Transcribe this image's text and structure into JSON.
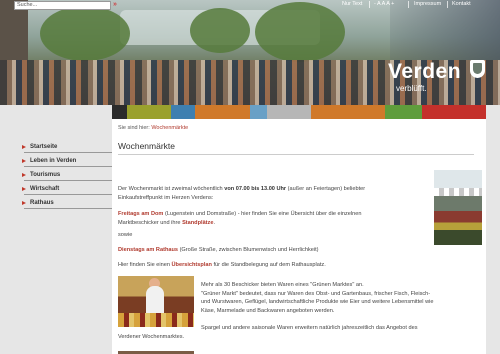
{
  "header": {
    "search_placeholder": "Suche...",
    "search_go": "»",
    "nav": {
      "nur_text": "Nur Text",
      "font_sizes": "- A A A +",
      "impressum": "Impressum",
      "kontakt": "Kontakt"
    },
    "brand_name": "Verden",
    "brand_tagline": "verblüfft."
  },
  "colorbar": [
    "#2b2b2b",
    "#9aa12d",
    "#3e7fb0",
    "#d0792a",
    "#69a0c6",
    "#b6b6b6",
    "#d0792a",
    "#5f9d3c",
    "#c4302b"
  ],
  "sidebar": {
    "items": [
      {
        "label": "Startseite"
      },
      {
        "label": "Leben in Verden"
      },
      {
        "label": "Tourismus"
      },
      {
        "label": "Wirtschaft"
      },
      {
        "label": "Rathaus"
      }
    ]
  },
  "main": {
    "breadcrumb_prefix": "Sie sind hier:",
    "breadcrumb_current": "Wochenmärkte",
    "title": "Wochenmärkte",
    "p1_a": "Der Wochenmarkt ist zweimal wöchentlich",
    "p1_b": "von 07.00 bis 13.00 Uhr",
    "p1_c": "(außer an Feiertagen) beliebter",
    "p1_d": "Einkaufstreffpunkt im Herzen Verdens:",
    "p2_red": "Freitags am Dom",
    "p2_a": "(Lugenstein und Domstraße) - hier finden Sie eine Übersicht über die einzelnen",
    "p2_b": "Marktbeschicker und ihre",
    "p2_red2": "Standplätze",
    "p2_dot": ".",
    "p3": "sowie",
    "p4_red": "Dienstags am Rathaus",
    "p4_a": "(Große Straße, zwischen Blumenwisch und Herrlichkeit)",
    "p5_a": "Hier finden Sie einen",
    "p5_red": "Übersichtsplan",
    "p5_b": "für die Standbelegung auf dem Rathausplatz.",
    "p6_1": "Mehr als 30 Beschicker bieten Waren eines \"Grünen Marktes\" an.",
    "p6_2": "\"Grüner Markt\" bedeutet, dass nur Waren des Obst- und Gartenbaus, frischer Fisch, Fleisch-",
    "p6_3": "und Wurstwaren, Geflügel, landwirtschaftliche Produkte wie Eier und weitere Lebensmittel wie",
    "p6_4": "Käse, Marmelade und Backwaren angeboten werden.",
    "p7_1": "Spargel und andere saisonale Waren erweitern natürlich jahreszeitlich das Angebot des",
    "p7_2": "Verdener Wochenmarktes."
  }
}
